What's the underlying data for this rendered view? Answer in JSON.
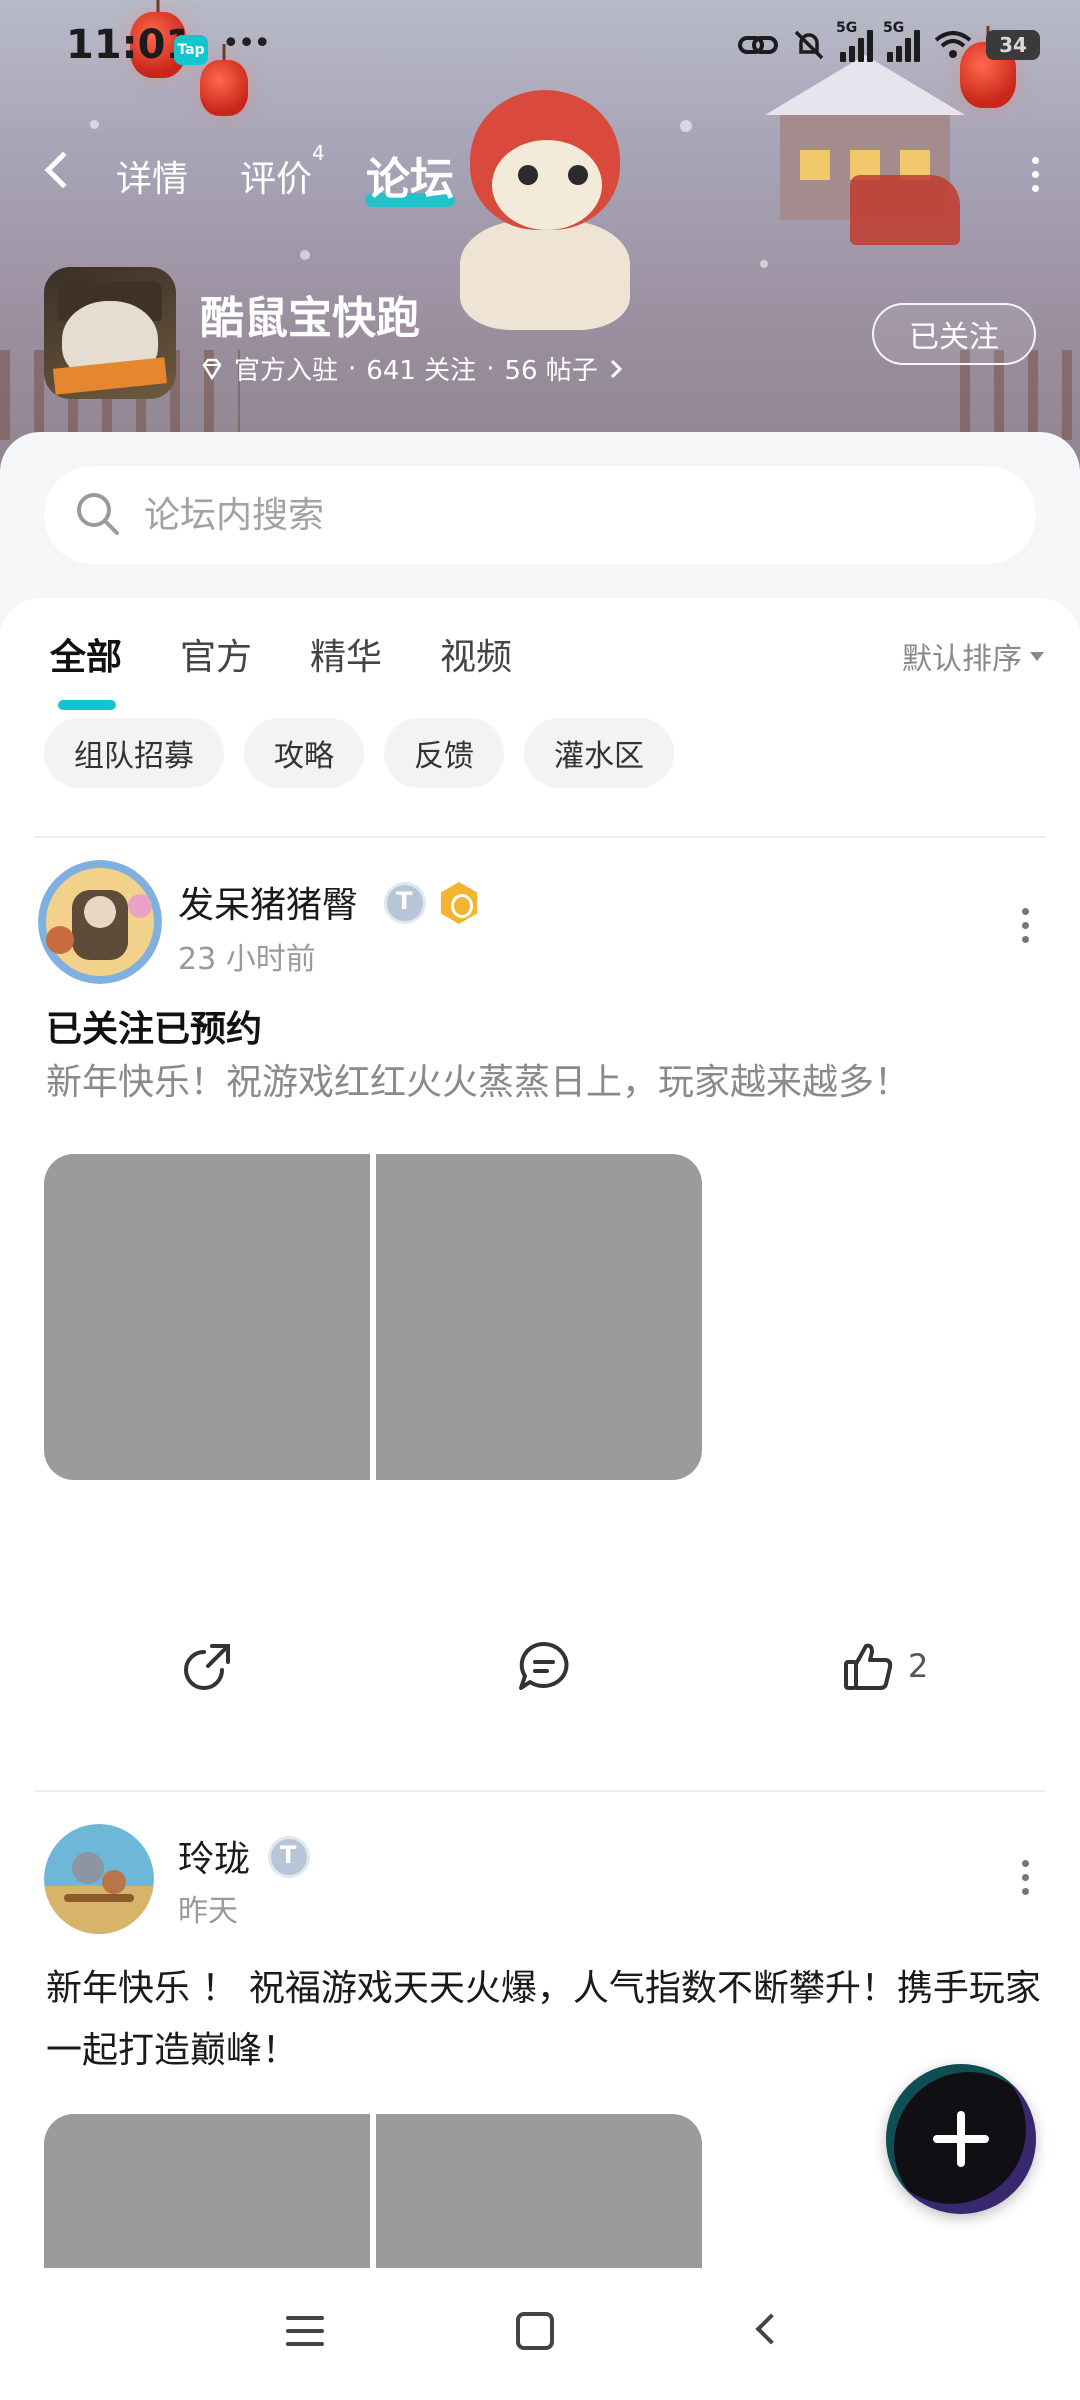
{
  "status_bar": {
    "time": "11:01",
    "tap_badge": "Tap",
    "more": "•••",
    "signal_labels": [
      "5G",
      "5G"
    ],
    "battery": "34"
  },
  "navbar": {
    "back_icon": "chevron-left-icon",
    "tabs": [
      {
        "label": "详情",
        "active": false
      },
      {
        "label": "评价",
        "active": false,
        "sup": "4"
      },
      {
        "label": "论坛",
        "active": true
      }
    ],
    "more_icon": "vertical-dots-icon"
  },
  "game": {
    "name": "酷鼠宝快跑",
    "meta_official": "官方入驻",
    "meta_follows": "641 关注",
    "meta_posts": "56 帖子",
    "separator": "·",
    "follow_button": "已关注"
  },
  "search": {
    "placeholder": "论坛内搜索"
  },
  "filter_tabs": [
    {
      "label": "全部",
      "active": true
    },
    {
      "label": "官方",
      "active": false
    },
    {
      "label": "精华",
      "active": false
    },
    {
      "label": "视频",
      "active": false
    }
  ],
  "sort_label": "默认排序",
  "chips": [
    "组队招募",
    "攻略",
    "反馈",
    "灌水区"
  ],
  "posts": [
    {
      "author": "发呆猪猪臀",
      "time": "23 小时前",
      "title": "已关注已预约",
      "body": "新年快乐！祝游戏红红火火蒸蒸日上，玩家越来越多！",
      "likes": "2"
    },
    {
      "author": "玲珑",
      "time": "昨天",
      "title": "",
      "body": "新年快乐 ！ 祝福游戏天天火爆，人气指数不断攀升！携手玩家一起打造巅峰！"
    }
  ],
  "colors": {
    "accent": "#15c5ce",
    "header_bg": "#a7a2b6",
    "image_placeholder": "#9b9b9b"
  }
}
